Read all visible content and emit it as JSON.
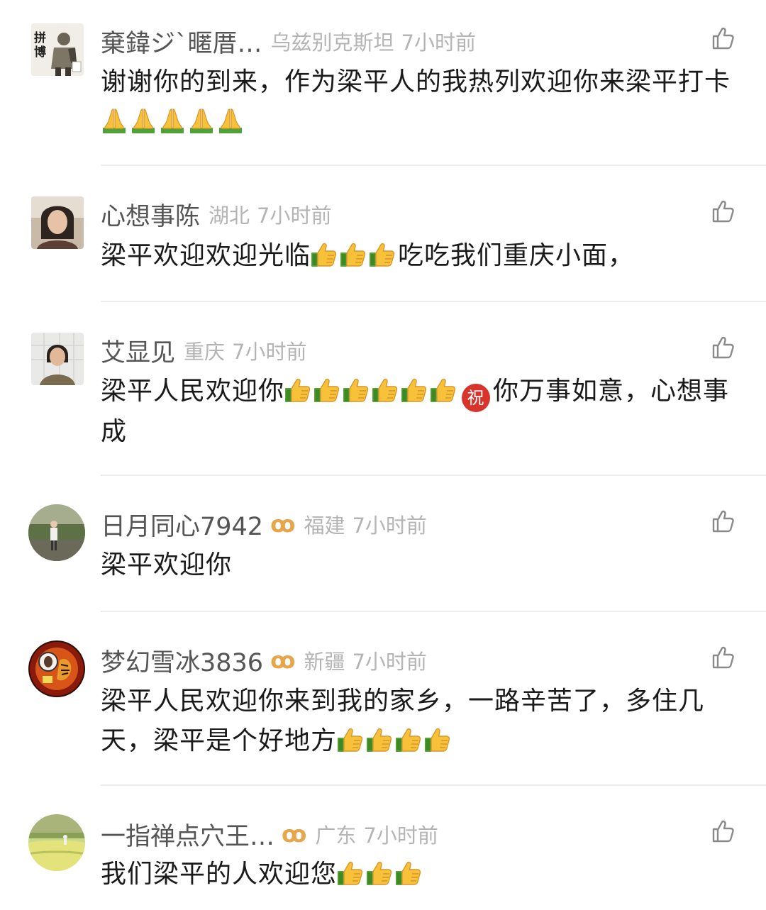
{
  "comments": [
    {
      "user": "棄鍏ジ`暱厝…",
      "location": "乌兹别克斯坦",
      "time": "7小时前",
      "text": "谢谢你的到来，作为梁平人的我热列欢迎你来梁平打卡",
      "emoji": "pray",
      "emoji_count": 5,
      "avatar_text": "拼博"
    },
    {
      "user": "心想事陈",
      "location": "湖北",
      "time": "7小时前",
      "text_before": "梁平欢迎欢迎光临",
      "text_after": "吃吃我们重庆小面，",
      "emoji": "thumbs-up",
      "emoji_count": 3
    },
    {
      "user": "艾显见",
      "location": "重庆",
      "time": "7小时前",
      "text_before": "梁平人民欢迎你",
      "badge": "祝",
      "text_after": "你万事如意，心想事成",
      "emoji": "thumbs-up",
      "emoji_count": 6
    },
    {
      "user": "日月同心7942",
      "vip": "ꝏ",
      "location": "福建",
      "time": "7小时前",
      "text": "梁平欢迎你"
    },
    {
      "user": "梦幻雪冰3836",
      "vip": "ꝏ",
      "location": "新疆",
      "time": "7小时前",
      "text": "梁平人民欢迎你来到我的家乡，一路辛苦了，多住几天，梁平是个好地方",
      "emoji": "thumbs-up",
      "emoji_count": 4
    },
    {
      "user": "一指禅点穴王…",
      "vip": "ꝏ",
      "location": "广东",
      "time": "7小时前",
      "text": "我们梁平的人欢迎您",
      "emoji": "thumbs-up",
      "emoji_count": 3
    }
  ],
  "colors": {
    "name": "#555555",
    "meta": "#b4b4b4",
    "text": "#1a1a1a",
    "vip": "#e7a64a",
    "divider": "#ececec",
    "badge": "#d8342c"
  },
  "icons": {
    "like": "thumbs-up-outline-icon"
  }
}
